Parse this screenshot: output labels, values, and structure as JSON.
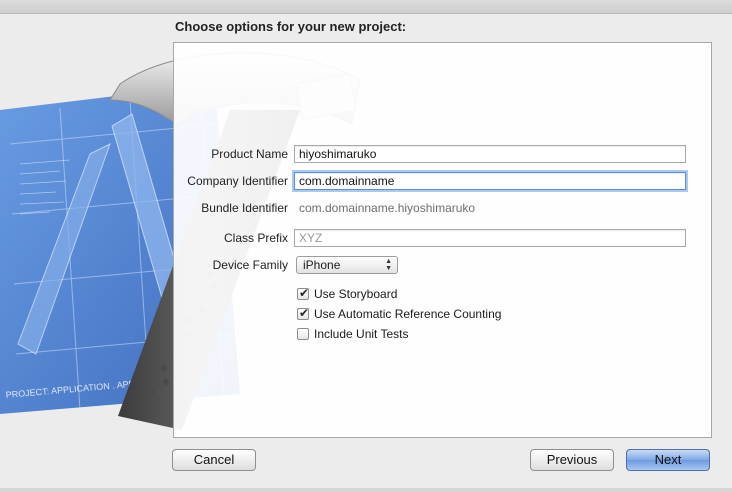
{
  "window": {
    "title": ""
  },
  "heading": "Choose options for your new project:",
  "form": {
    "product_name": {
      "label": "Product Name",
      "value": "hiyoshimaruko"
    },
    "company_identifier": {
      "label": "Company Identifier",
      "value": "com.domainname"
    },
    "bundle_identifier": {
      "label": "Bundle Identifier",
      "value": "com.domainname.hiyoshimaruko"
    },
    "class_prefix": {
      "label": "Class Prefix",
      "value": "",
      "placeholder": "XYZ"
    },
    "device_family": {
      "label": "Device Family",
      "value": "iPhone"
    },
    "checkboxes": [
      {
        "label": "Use Storyboard",
        "checked": true
      },
      {
        "label": "Use Automatic Reference Counting",
        "checked": true
      },
      {
        "label": "Include Unit Tests",
        "checked": false
      }
    ]
  },
  "buttons": {
    "cancel": "Cancel",
    "previous": "Previous",
    "next": "Next"
  },
  "artwork": {
    "blueprint_caption": "PROJECT: APPLICATION . APP"
  },
  "colors": {
    "accent": "#6d9be0",
    "focus_ring": "#a9c8f2",
    "blueprint": "#3f79d3"
  }
}
